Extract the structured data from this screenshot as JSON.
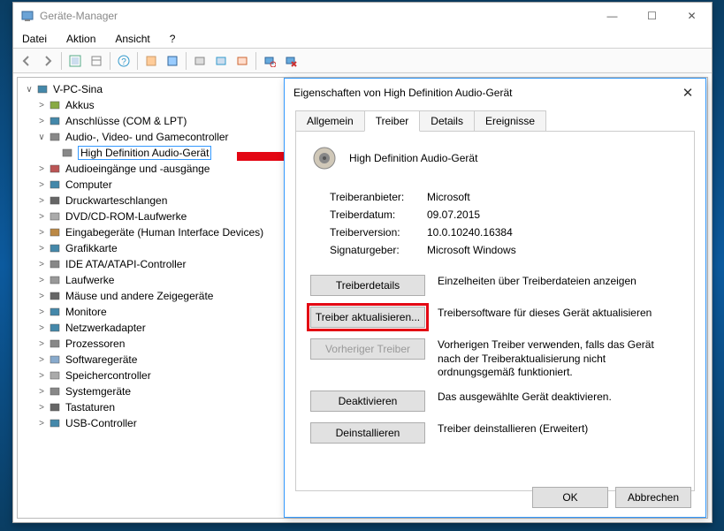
{
  "window": {
    "title": "Geräte-Manager",
    "menu": {
      "file": "Datei",
      "action": "Aktion",
      "view": "Ansicht",
      "help": "?"
    },
    "sys": {
      "min": "—",
      "max": "☐",
      "close": "✕"
    }
  },
  "tree": {
    "root": "V-PC-Sina",
    "items": [
      {
        "label": "Akkus",
        "icon": "battery"
      },
      {
        "label": "Anschlüsse (COM & LPT)",
        "icon": "port"
      },
      {
        "label": "Audio-, Video- und Gamecontroller",
        "icon": "speaker",
        "expanded": true,
        "children": [
          {
            "label": "High Definition Audio-Gerät",
            "icon": "speaker",
            "selected": true
          }
        ]
      },
      {
        "label": "Audioeingänge und -ausgänge",
        "icon": "audio-io"
      },
      {
        "label": "Computer",
        "icon": "computer"
      },
      {
        "label": "Druckwarteschlangen",
        "icon": "printer"
      },
      {
        "label": "DVD/CD-ROM-Laufwerke",
        "icon": "disc"
      },
      {
        "label": "Eingabegeräte (Human Interface Devices)",
        "icon": "hid"
      },
      {
        "label": "Grafikkarte",
        "icon": "display"
      },
      {
        "label": "IDE ATA/ATAPI-Controller",
        "icon": "ide"
      },
      {
        "label": "Laufwerke",
        "icon": "drive"
      },
      {
        "label": "Mäuse und andere Zeigegeräte",
        "icon": "mouse"
      },
      {
        "label": "Monitore",
        "icon": "monitor"
      },
      {
        "label": "Netzwerkadapter",
        "icon": "network"
      },
      {
        "label": "Prozessoren",
        "icon": "cpu"
      },
      {
        "label": "Softwaregeräte",
        "icon": "software"
      },
      {
        "label": "Speichercontroller",
        "icon": "storage"
      },
      {
        "label": "Systemgeräte",
        "icon": "system"
      },
      {
        "label": "Tastaturen",
        "icon": "keyboard"
      },
      {
        "label": "USB-Controller",
        "icon": "usb"
      }
    ]
  },
  "dialog": {
    "title": "Eigenschaften von High Definition Audio-Gerät",
    "close": "✕",
    "tabs": {
      "general": "Allgemein",
      "driver": "Treiber",
      "details": "Details",
      "events": "Ereignisse"
    },
    "active_tab": "driver",
    "device_name": "High Definition Audio-Gerät",
    "info": {
      "provider_k": "Treiberanbieter:",
      "provider_v": "Microsoft",
      "date_k": "Treiberdatum:",
      "date_v": "09.07.2015",
      "version_k": "Treiberversion:",
      "version_v": "10.0.10240.16384",
      "signer_k": "Signaturgeber:",
      "signer_v": "Microsoft Windows"
    },
    "buttons": {
      "details": "Treiberdetails",
      "details_desc": "Einzelheiten über Treiberdateien anzeigen",
      "update": "Treiber aktualisieren...",
      "update_desc": "Treibersoftware für dieses Gerät aktualisieren",
      "rollback": "Vorheriger Treiber",
      "rollback_desc": "Vorherigen Treiber verwenden, falls das Gerät nach der Treiberaktualisierung nicht ordnungsgemäß funktioniert.",
      "disable": "Deaktivieren",
      "disable_desc": "Das ausgewählte Gerät deaktivieren.",
      "uninstall": "Deinstallieren",
      "uninstall_desc": "Treiber deinstallieren (Erweitert)"
    },
    "footer": {
      "ok": "OK",
      "cancel": "Abbrechen"
    }
  }
}
